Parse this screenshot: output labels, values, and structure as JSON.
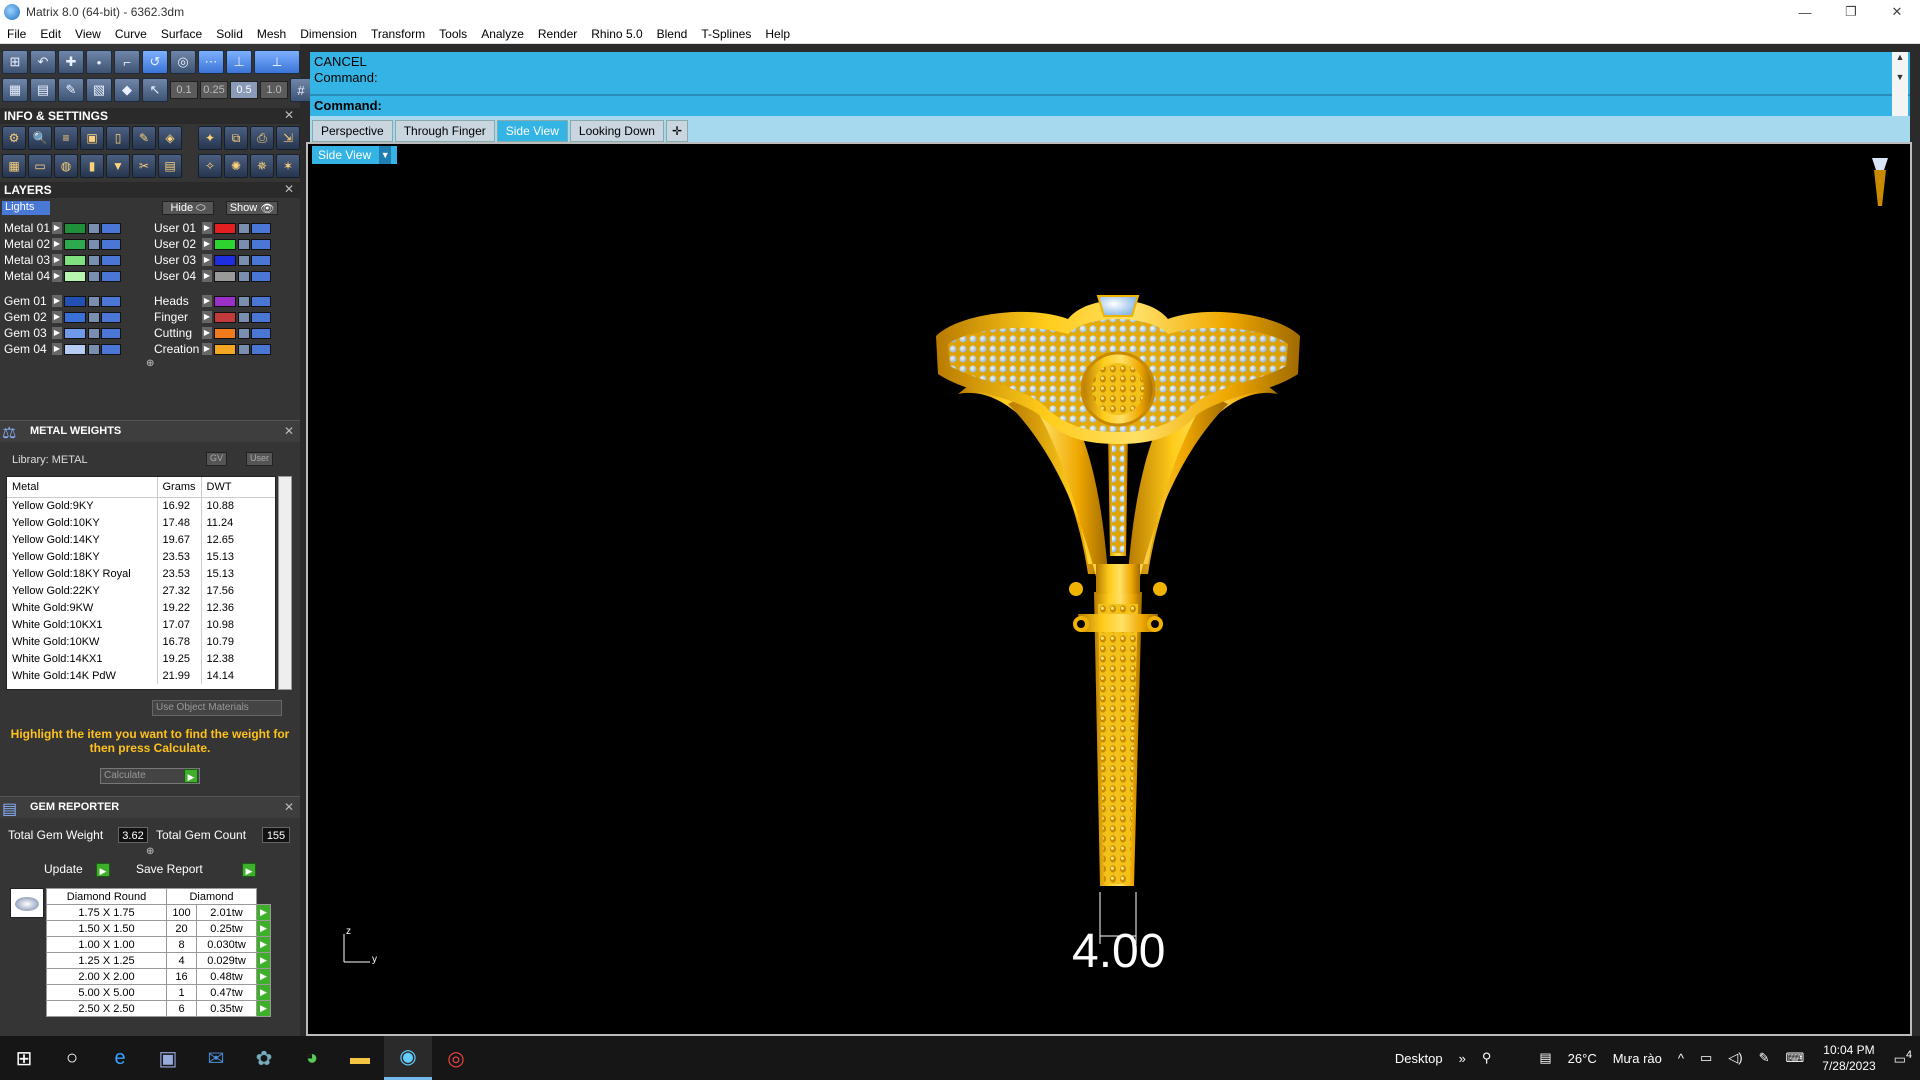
{
  "window": {
    "title": "Matrix 8.0 (64-bit) - 6362.3dm",
    "minimize": "—",
    "restore": "❐",
    "close": "✕"
  },
  "menu": [
    "File",
    "Edit",
    "View",
    "Curve",
    "Surface",
    "Solid",
    "Mesh",
    "Dimension",
    "Transform",
    "Tools",
    "Analyze",
    "Render",
    "Rhino 5.0",
    "Blend",
    "T-Splines",
    "Help"
  ],
  "snap_values": [
    "0.1",
    "0.25",
    "0.5",
    "1.0"
  ],
  "info_settings": {
    "title": "INFO & SETTINGS"
  },
  "layers": {
    "title": "LAYERS",
    "lights_label": "Lights",
    "hide_label": "Hide",
    "show_label": "Show",
    "left": [
      {
        "name": "Metal 01",
        "color": "#1f8f3a"
      },
      {
        "name": "Metal 02",
        "color": "#2eaa4e"
      },
      {
        "name": "Metal 03",
        "color": "#7ee07e"
      },
      {
        "name": "Metal 04",
        "color": "#b8f5b0"
      },
      {
        "name": "Gem 01",
        "color": "#2251b3"
      },
      {
        "name": "Gem 02",
        "color": "#3a6fd8"
      },
      {
        "name": "Gem 03",
        "color": "#6e9ae8"
      },
      {
        "name": "Gem 04",
        "color": "#b7ccf2"
      }
    ],
    "right": [
      {
        "name": "User 01",
        "color": "#e22020"
      },
      {
        "name": "User 02",
        "color": "#2ed42e"
      },
      {
        "name": "User 03",
        "color": "#1f2fe0"
      },
      {
        "name": "User 04",
        "color": "#9a9a9a"
      },
      {
        "name": "Heads",
        "color": "#9b30c8"
      },
      {
        "name": "Finger",
        "color": "#c23a3a"
      },
      {
        "name": "Cutting",
        "color": "#f07a1c"
      },
      {
        "name": "Creation",
        "color": "#f5a623"
      }
    ]
  },
  "metal_weights": {
    "title": "METAL WEIGHTS",
    "library": "Library: METAL",
    "gv_label": "GV",
    "user_label": "User",
    "headers": [
      "Metal",
      "Grams",
      "DWT"
    ],
    "rows": [
      [
        "Yellow Gold:9KY",
        "16.92",
        "10.88"
      ],
      [
        "Yellow Gold:10KY",
        "17.48",
        "11.24"
      ],
      [
        "Yellow Gold:14KY",
        "19.67",
        "12.65"
      ],
      [
        "Yellow Gold:18KY",
        "23.53",
        "15.13"
      ],
      [
        "Yellow Gold:18KY Royal",
        "23.53",
        "15.13"
      ],
      [
        "Yellow Gold:22KY",
        "27.32",
        "17.56"
      ],
      [
        "White Gold:9KW",
        "19.22",
        "12.36"
      ],
      [
        "White Gold:10KX1",
        "17.07",
        "10.98"
      ],
      [
        "White Gold:10KW",
        "16.78",
        "10.79"
      ],
      [
        "White Gold:14KX1",
        "19.25",
        "12.38"
      ],
      [
        "White Gold:14K PdW",
        "21.99",
        "14.14"
      ]
    ],
    "use_object_materials": "Use Object Materials",
    "hint": "Highlight the item you want to find the weight for then press Calculate.",
    "calculate": "Calculate"
  },
  "gem_reporter": {
    "title": "GEM REPORTER",
    "total_weight_label": "Total Gem Weight",
    "total_weight": "3.62",
    "total_count_label": "Total Gem Count",
    "total_count": "155",
    "update": "Update",
    "save_report": "Save Report",
    "headers": [
      "Diamond Round",
      "Diamond"
    ],
    "rows": [
      [
        "1.75 X 1.75",
        "100",
        "2.01tw"
      ],
      [
        "1.50 X 1.50",
        "20",
        "0.25tw"
      ],
      [
        "1.00 X 1.00",
        "8",
        "0.030tw"
      ],
      [
        "1.25 X 1.25",
        "4",
        "0.029tw"
      ],
      [
        "2.00 X 2.00",
        "16",
        "0.48tw"
      ],
      [
        "5.00 X 5.00",
        "1",
        "0.47tw"
      ],
      [
        "2.50 X 2.50",
        "6",
        "0.35tw"
      ]
    ]
  },
  "command": {
    "line1": "CANCEL",
    "line2": "Command:",
    "prompt": "Command:"
  },
  "viewport_tabs": [
    {
      "label": "Perspective",
      "active": false
    },
    {
      "label": "Through Finger",
      "active": false
    },
    {
      "label": "Side View",
      "active": true
    },
    {
      "label": "Looking Down",
      "active": false
    }
  ],
  "viewport": {
    "label": "Side View",
    "dimension": "4.00",
    "axis_z": "z",
    "axis_y": "y"
  },
  "taskbar": {
    "desktop": "Desktop",
    "temperature": "26°C",
    "weather": "Mưa rào",
    "time": "10:04 PM",
    "date": "7/28/2023",
    "notifications": "4"
  }
}
